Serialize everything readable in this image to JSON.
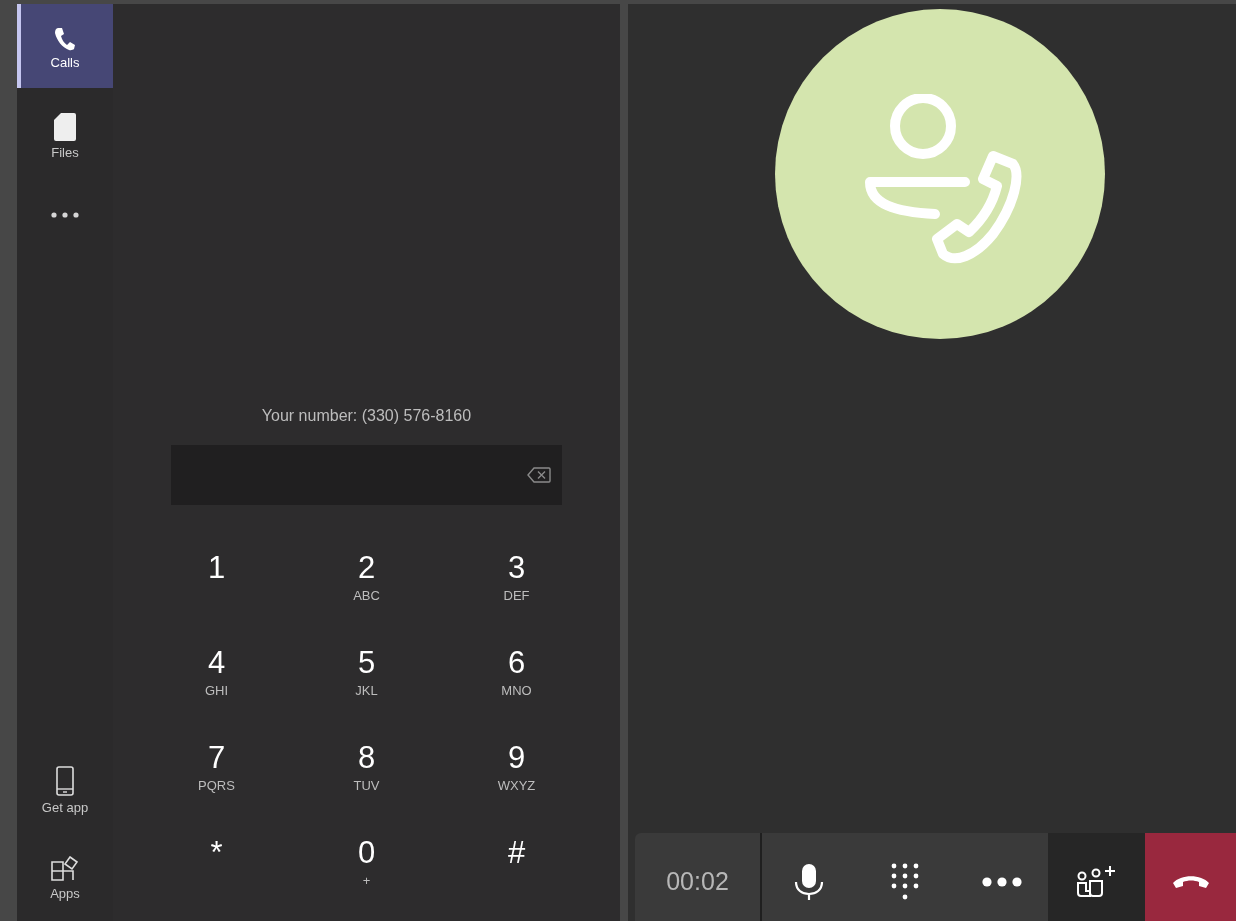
{
  "sidebar": {
    "top_items": [
      {
        "label": "Calls",
        "kind": "phone",
        "selected": true
      },
      {
        "label": "Files",
        "kind": "file",
        "selected": false
      },
      {
        "kind": "more",
        "selected": false
      }
    ],
    "bottom_items": [
      {
        "label": "Get app",
        "kind": "mobile",
        "selected": false
      },
      {
        "label": "Apps",
        "kind": "apps",
        "selected": false
      }
    ]
  },
  "dial_pad": {
    "your_number": "Your number: (330) 576-8160",
    "keys": [
      {
        "digit": "1"
      },
      {
        "digit": "2",
        "letters": "ABC"
      },
      {
        "digit": "3",
        "letters": "DEF"
      },
      {
        "digit": "4",
        "letters": "GHI"
      },
      {
        "digit": "5",
        "letters": "JKL"
      },
      {
        "digit": "6",
        "letters": "MNO"
      },
      {
        "digit": "7",
        "letters": "PQRS"
      },
      {
        "digit": "8",
        "letters": "TUV"
      },
      {
        "digit": "9",
        "letters": "WXYZ"
      },
      {
        "digit": "*"
      },
      {
        "digit": "0",
        "letters": "+"
      },
      {
        "digit": "#"
      }
    ]
  },
  "call": {
    "timer": "00:02",
    "controls": [
      {
        "kind": "mic"
      },
      {
        "kind": "dialpad"
      },
      {
        "kind": "more"
      },
      {
        "kind": "add-people"
      },
      {
        "kind": "hang-up"
      }
    ]
  }
}
